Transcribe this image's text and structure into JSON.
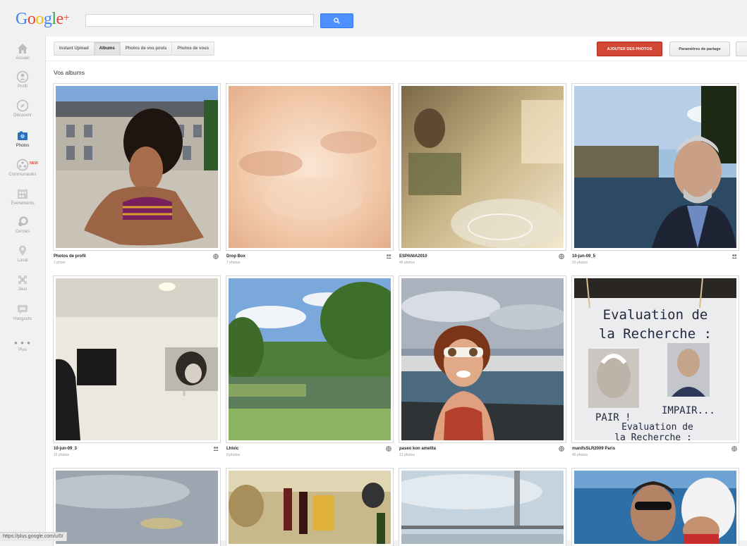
{
  "header": {
    "logo_text": "Google",
    "logo_plus": "+",
    "search_placeholder": ""
  },
  "sidebar": {
    "items": [
      {
        "label": "Accueil",
        "icon": "home-icon"
      },
      {
        "label": "Profil",
        "icon": "profile-icon"
      },
      {
        "label": "Découvrir",
        "icon": "compass-icon"
      },
      {
        "label": "Photos",
        "icon": "photos-icon",
        "active": true
      },
      {
        "label": "Communautés",
        "icon": "communities-icon",
        "badge": "NEW"
      },
      {
        "label": "Événements",
        "icon": "events-icon"
      },
      {
        "label": "Cercles",
        "icon": "circles-icon"
      },
      {
        "label": "Local",
        "icon": "local-icon"
      },
      {
        "label": "Jeux",
        "icon": "games-icon"
      },
      {
        "label": "Hangouts",
        "icon": "hangouts-icon"
      }
    ],
    "more_label": "Plus"
  },
  "toolbar": {
    "tabs": [
      {
        "label": "Instant Upload"
      },
      {
        "label": "Albums",
        "active": true
      },
      {
        "label": "Photos de vos posts"
      },
      {
        "label": "Photos de vous"
      }
    ],
    "add_button": "AJOUTER DES PHOTOS",
    "share_button": "Paramètres de partage"
  },
  "section_title": "Vos albums",
  "albums": [
    {
      "title": "Photos de profil",
      "count": "1 photo",
      "share_icon": "globe-icon"
    },
    {
      "title": "Drop Box",
      "count": "7 photos",
      "share_icon": "people-icon"
    },
    {
      "title": "ESPANIA2010",
      "count": "46 photos",
      "share_icon": "globe-icon"
    },
    {
      "title": "10-jun-09_5",
      "count": "20 photos",
      "share_icon": "people-icon"
    },
    {
      "title": "10-jun-09_3",
      "count": "16 photos",
      "share_icon": "people-icon"
    },
    {
      "title": "Lhivic",
      "count": "8 photos",
      "share_icon": "globe-icon"
    },
    {
      "title": "paseo kon amelita",
      "count": "12 photos",
      "share_icon": "globe-icon"
    },
    {
      "title": "manifsSLR2009 Paris",
      "count": "46 photos",
      "share_icon": "globe-icon"
    },
    {
      "title": "",
      "count": "",
      "share_icon": ""
    },
    {
      "title": "",
      "count": "",
      "share_icon": ""
    },
    {
      "title": "",
      "count": "",
      "share_icon": ""
    },
    {
      "title": "",
      "count": "",
      "share_icon": ""
    }
  ],
  "photo_text": {
    "sign_line1": "Evaluation de",
    "sign_line2": "la Recherche :",
    "sign_pair": "PAIR !",
    "sign_impair": "IMPAIR...",
    "sign_line3": "Evaluation de",
    "sign_line4": "la Recherche :"
  },
  "statusbar": {
    "url": "https://plus.google.com/u/0/"
  },
  "colors": {
    "accent_red": "#d14836",
    "accent_blue": "#4d90fe"
  }
}
